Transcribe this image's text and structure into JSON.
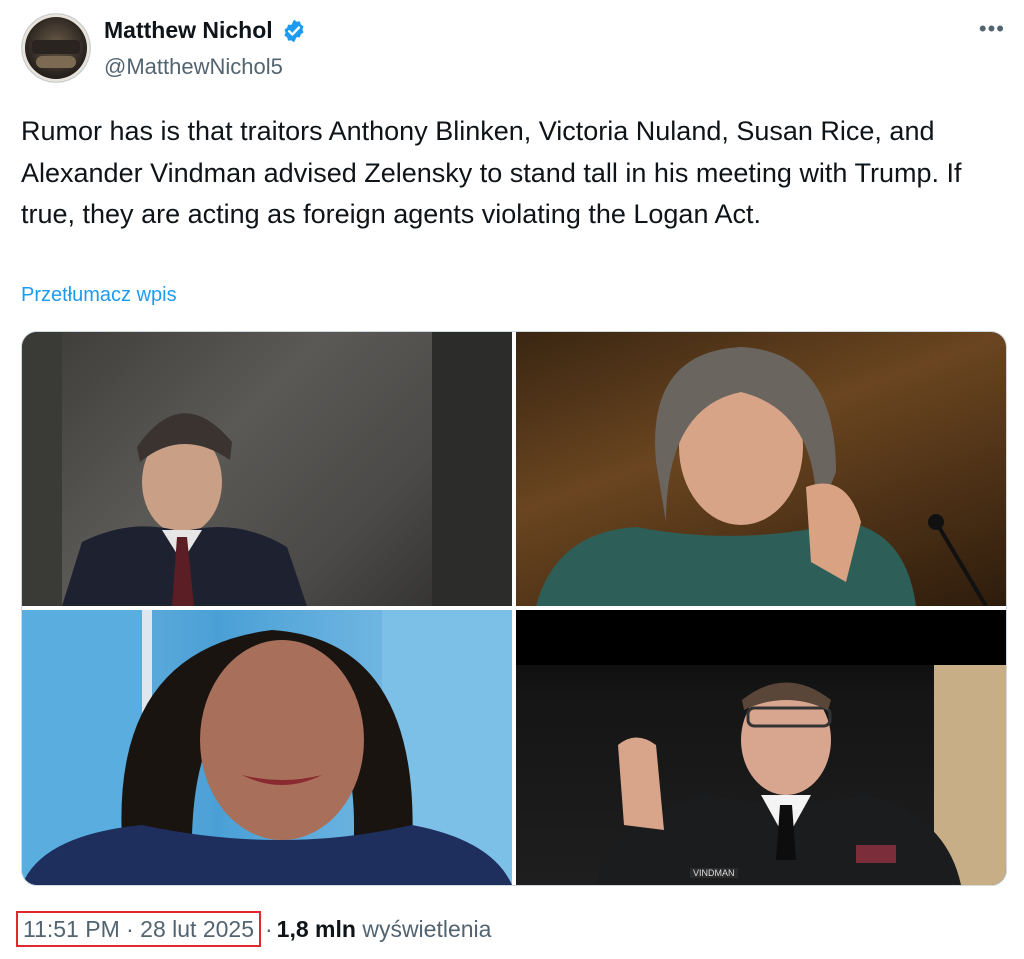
{
  "author": {
    "name": "Matthew Nichol",
    "handle": "@MatthewNichol5",
    "verified": true,
    "avatar_icon": "user-avatar"
  },
  "menu": {
    "more_label": "•••"
  },
  "tweet": {
    "text": "Rumor has is that traitors Anthony Blinken, Victoria Nuland, Susan Rice, and Alexander Vindman advised Zelensky to stand tall in his meeting with Trump. If true, they are acting as foreign agents violating the Logan Act.",
    "translate_label": "Przetłumacz wpis"
  },
  "media": {
    "photos": [
      {
        "icon": "photo-man-in-suit"
      },
      {
        "icon": "photo-woman-at-hearing"
      },
      {
        "icon": "photo-woman-smiling"
      },
      {
        "icon": "photo-officer-taking-oath"
      }
    ],
    "nameplate": "VINDMAN"
  },
  "footer": {
    "timestamp": "11:51 PM · 28 lut 2025",
    "separator": "·",
    "views_count": "1,8 mln",
    "views_label": "wyświetlenia"
  },
  "colors": {
    "link": "#1d9bf0",
    "verified": "#1d9bf0",
    "text": "#0f1419",
    "secondary": "#536471",
    "highlight_box": "#e0282e"
  }
}
